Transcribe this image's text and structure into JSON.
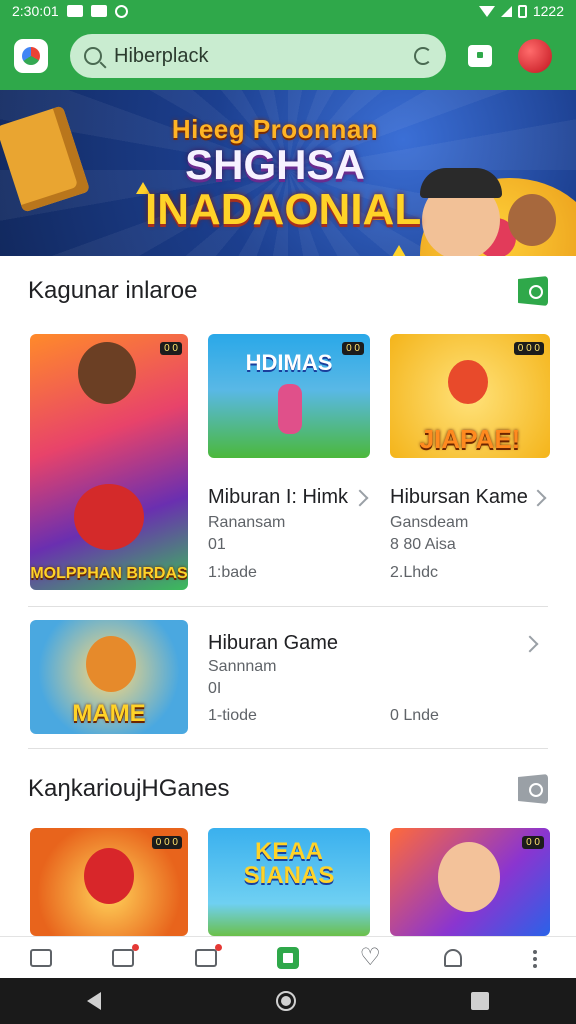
{
  "status_bar": {
    "time_left": "2:30:01",
    "time_right": "1222"
  },
  "search": {
    "placeholder": "Hiberplack"
  },
  "banner": {
    "line1": "Hieeg Proonnan",
    "line2": "SHGHSA",
    "line3": "INADAONIAL"
  },
  "section1": {
    "title": "Kagunar inlaroe",
    "games": [
      {
        "title": "Miburan I: Himk",
        "subtitle": "Ranansam",
        "count": "01",
        "meta": "1:bade",
        "thumb_label": "MOLPPHAN BIRDAS",
        "tag": "0 0"
      },
      {
        "title": "Hibursan Kame",
        "subtitle": "Gansdeam",
        "count": "8 80 Aisa",
        "meta": "2.Lhdc",
        "thumb_label": "HDIMAS",
        "tag": "0 0"
      },
      {
        "title": "",
        "subtitle": "",
        "count": "",
        "meta": "",
        "thumb_label": "JIAPAE!",
        "tag": "0 0 0"
      }
    ]
  },
  "featured": {
    "title": "Hiburan Game",
    "subtitle": "Sannnam",
    "count": "0I",
    "meta": "1-tiode",
    "meta_right": "0 Lnde",
    "thumb_label": "MAME"
  },
  "section2": {
    "title": "KaŋkarioujHGanes",
    "thumbs": [
      {
        "label": "",
        "tag": "0 0 0"
      },
      {
        "label": "KEAA SIANAS"
      },
      {
        "label": "",
        "tag": "0 0"
      }
    ]
  },
  "colors": {
    "brand_green": "#2fa84a",
    "search_bg": "#c9ecd0",
    "text_primary": "#202124",
    "text_secondary": "#5f6368"
  },
  "icons": [
    "app-logo-icon",
    "search-icon",
    "mic-icon",
    "notification-box-icon",
    "profile-avatar-icon",
    "home-icon",
    "store-icon",
    "library-icon",
    "games-icon",
    "wishlist-heart-icon",
    "bell-icon",
    "more-icon",
    "back-icon",
    "home-circle-icon",
    "recents-icon"
  ]
}
